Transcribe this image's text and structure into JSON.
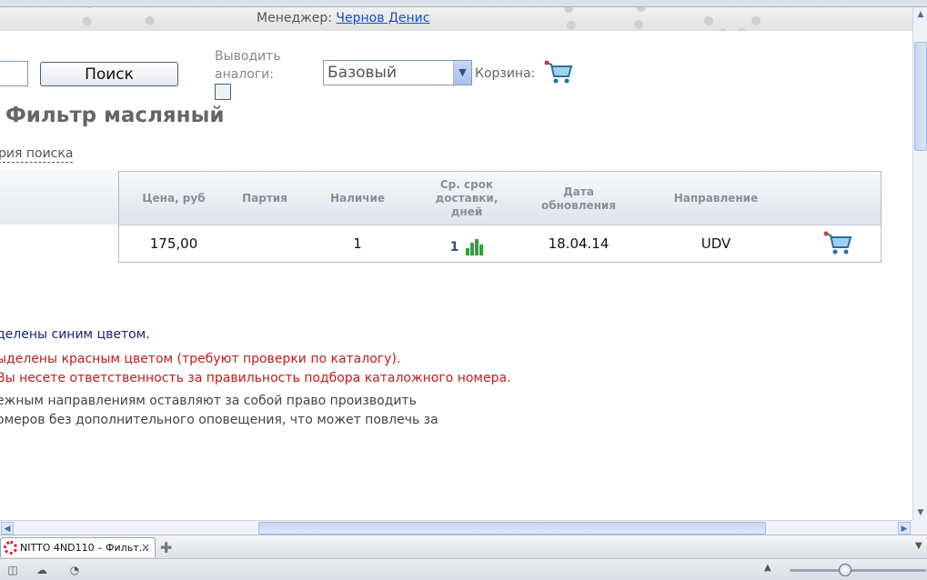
{
  "header": {
    "manager_label": "Менеджер:",
    "manager_name": "Чернов Денис"
  },
  "search": {
    "button_label": "Поиск",
    "analogs_label": "Выводить аналоги:",
    "price_type_selected": "Базовый",
    "cart_label": "Корзина:"
  },
  "product": {
    "title": "Фильтр масляный",
    "history_link": "рия поиска"
  },
  "table": {
    "headers": {
      "price": "Цена, руб",
      "batch": "Партия",
      "stock": "Наличие",
      "delivery": "Ср. срок доставки, дней",
      "updated": "Дата обновления",
      "direction": "Направление"
    },
    "row": {
      "price": "175,00",
      "batch": "",
      "stock": "1",
      "delivery": "1",
      "updated": "18.04.14",
      "direction": "UDV"
    },
    "delivery_bars": [
      0.45,
      0.8,
      1.0,
      0.65
    ]
  },
  "notes": {
    "blue": "делены синим цветом.",
    "red1": "ыделены красным цветом (требуют проверки по каталогу).",
    "red2": "Вы несете ответственность за правильность подбора каталожного номера.",
    "gray1": "ежным направлениям оставляют за собой право производить",
    "gray2": "омеров без дополнительного оповещения, что может повлечь за"
  },
  "browser": {
    "tab_title": "NITTO 4ND110 – Фильт...",
    "tab_close": "×",
    "new_tab": "✚"
  },
  "colors": {
    "accent_blue": "#1a237e",
    "warn_red": "#c21d1d",
    "bar_green": "#2f9e3f",
    "link_blue": "#1a4fc0"
  },
  "icons": {
    "cart": "cart-icon",
    "bars": "bar-chart-icon"
  }
}
